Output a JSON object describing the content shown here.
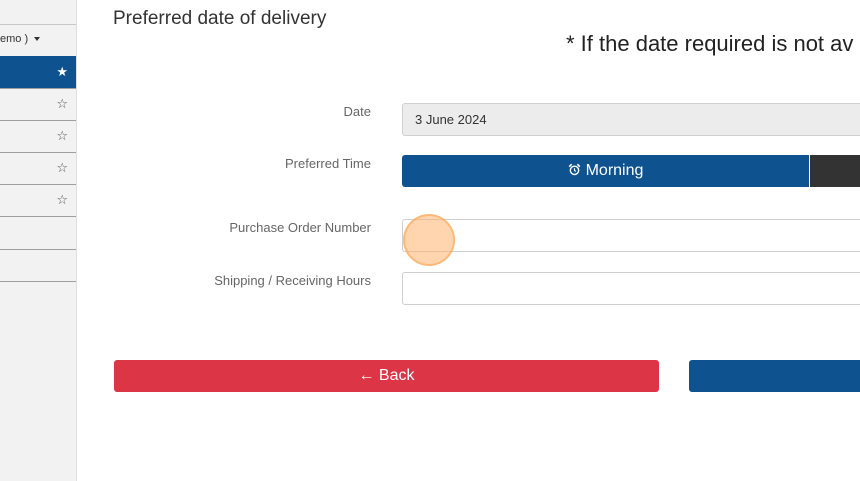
{
  "sidebar": {
    "header_label": "emo )",
    "rows": [
      {
        "active": true
      },
      {
        "active": false
      },
      {
        "active": false
      },
      {
        "active": false
      },
      {
        "active": false
      }
    ]
  },
  "form": {
    "section_title": "Preferred date of delivery",
    "notice": "* If the date required is not av",
    "date_label": "Date",
    "date_value": "3 June 2024",
    "time_label": "Preferred Time",
    "time_morning": "Morning",
    "po_label": "Purchase Order Number",
    "po_value": "",
    "hours_label": "Shipping / Receiving Hours",
    "hours_value": ""
  },
  "actions": {
    "back_label": "← Back"
  },
  "colors": {
    "primary": "#0e5290",
    "danger": "#dc3545",
    "dark": "#333333"
  }
}
